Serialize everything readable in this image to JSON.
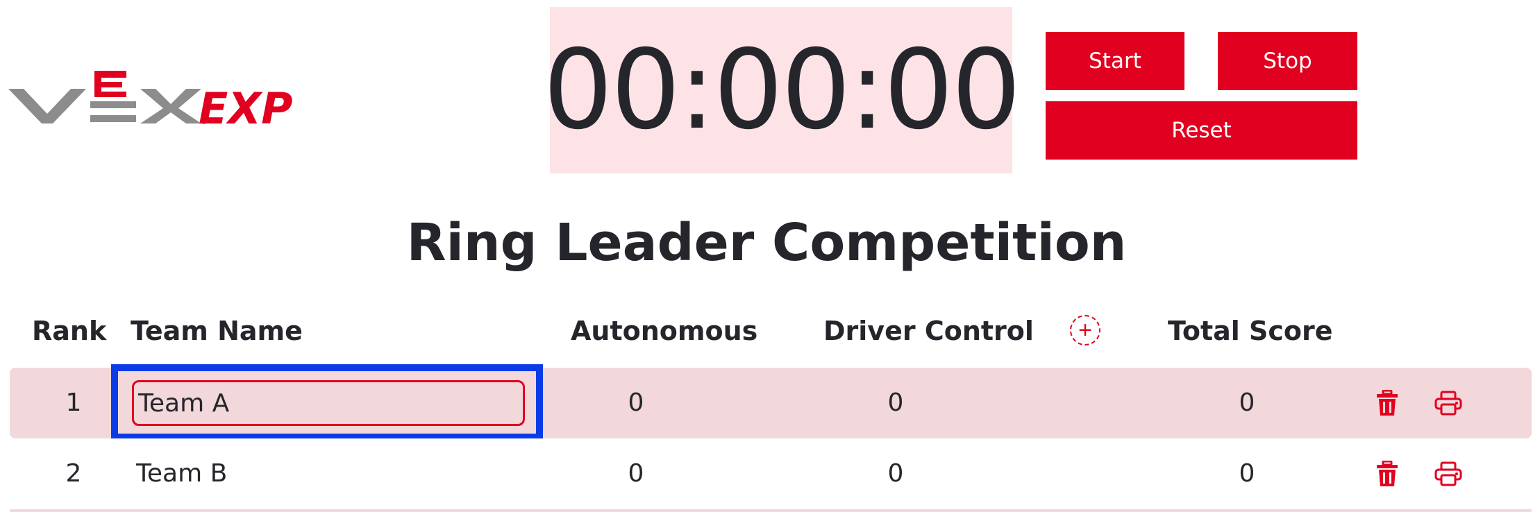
{
  "logo": {
    "brand": "VEX",
    "product": "EXP",
    "colors": {
      "vex": "#8c8c8c",
      "e_accent": "#e1001f",
      "exp": "#e1001f"
    }
  },
  "timer": {
    "display": "00:00:00"
  },
  "controls": {
    "start_label": "Start",
    "stop_label": "Stop",
    "reset_label": "Reset"
  },
  "page": {
    "title": "Ring Leader Competition"
  },
  "table": {
    "headers": {
      "rank": "Rank",
      "team_name": "Team Name",
      "autonomous": "Autonomous",
      "driver_control": "Driver Control",
      "total_score": "Total Score"
    },
    "add_column_icon": "plus-circle-icon",
    "rows": [
      {
        "rank": "1",
        "team_name": "Team A",
        "autonomous": "0",
        "driver_control": "0",
        "total_score": "0",
        "focused": true
      },
      {
        "rank": "2",
        "team_name": "Team B",
        "autonomous": "0",
        "driver_control": "0",
        "total_score": "0",
        "focused": false
      }
    ],
    "row_icons": [
      "trash-icon",
      "print-icon"
    ]
  },
  "colors": {
    "accent": "#e1001f",
    "timer_bg": "#fde3e6",
    "row_highlight": "#f2d8db",
    "focus_ring": "#0b3be6",
    "text": "#25262b"
  }
}
